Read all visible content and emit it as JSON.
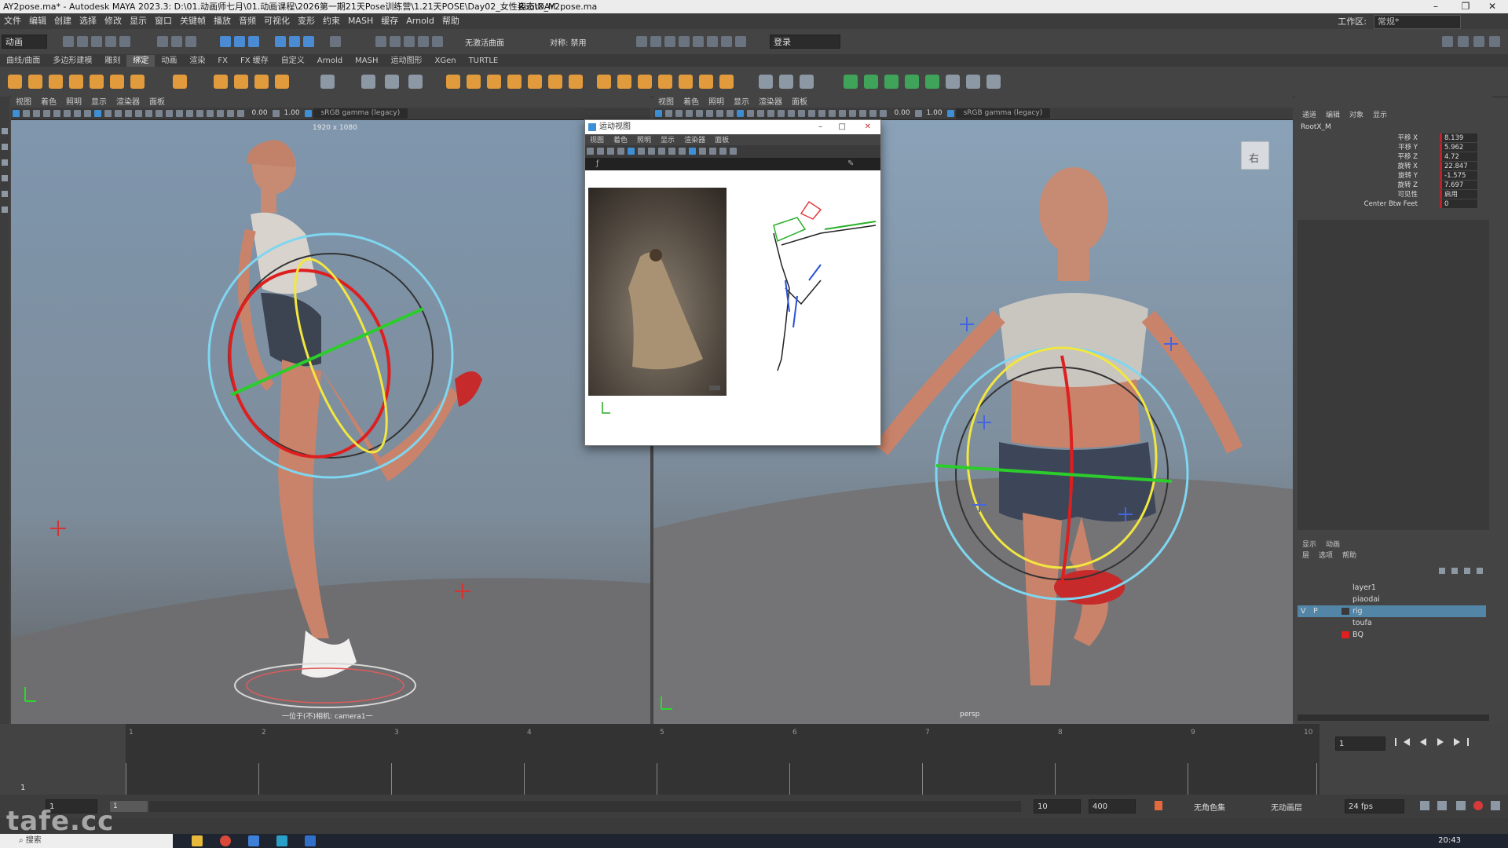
{
  "titlebar": {
    "title": "AY2pose.ma* - Autodesk MAYA 2023.3: D:\\01.动画师七月\\01.动画课程\\2026第一期21天Pose训练营\\1.21天POSE\\Day02_女性姿态\\DAY2pose.ma",
    "selection": "RootX_M",
    "minimize": "–",
    "restore": "❐",
    "close": "✕"
  },
  "menubar": {
    "items": [
      "文件",
      "编辑",
      "创建",
      "选择",
      "修改",
      "显示",
      "窗口",
      "关键帧",
      "播放",
      "音频",
      "可视化",
      "变形",
      "约束",
      "MASH",
      "缓存",
      "Arnold",
      "帮助"
    ],
    "workspace_label": "工作区:",
    "workspace_value": "常规*"
  },
  "statusline": {
    "mode": "动画",
    "symmetry": "无激活曲面",
    "symmetry_off": "对称: 禁用",
    "login": "登录"
  },
  "shelf": {
    "tabs": [
      "曲线/曲面",
      "多边形建模",
      "雕刻",
      "绑定",
      "动画",
      "渲染",
      "FX",
      "FX 缓存",
      "自定义",
      "Arnold",
      "MASH",
      "运动图形",
      "XGen",
      "TURTLE"
    ],
    "active_tab": 3
  },
  "viewport_left": {
    "menu": [
      "视图",
      "着色",
      "照明",
      "显示",
      "渲染器",
      "面板"
    ],
    "value1": "0.00",
    "value2": "1.00",
    "gamma": "sRGB gamma (legacy)",
    "resolution": "1920 x 1080",
    "camera_label": "一位于(不)相机: camera1一"
  },
  "viewport_right": {
    "menu": [
      "视图",
      "着色",
      "照明",
      "显示",
      "渲染器",
      "面板"
    ],
    "value1": "0.00",
    "value2": "1.00",
    "gamma": "sRGB gamma (legacy)",
    "camera_label": "persp",
    "viewcube_label": "右"
  },
  "float_window": {
    "title": "运动视图",
    "menu": [
      "视图",
      "着色",
      "照明",
      "显示",
      "渲染器",
      "面板"
    ]
  },
  "channel_box": {
    "tabs": [
      "通道",
      "编辑",
      "对象",
      "显示"
    ],
    "object": "RootX_M",
    "channels": [
      {
        "label": "平移 X",
        "value": "8.139"
      },
      {
        "label": "平移 Y",
        "value": "5.962"
      },
      {
        "label": "平移 Z",
        "value": "4.72"
      },
      {
        "label": "旋转 X",
        "value": "22.847"
      },
      {
        "label": "旋转 Y",
        "value": "-1.575"
      },
      {
        "label": "旋转 Z",
        "value": "7.697"
      },
      {
        "label": "可见性",
        "value": "启用"
      },
      {
        "label": "Center Btw Feet",
        "value": "0"
      }
    ]
  },
  "layer_editor": {
    "tabs": [
      "显示",
      "动画"
    ],
    "menu": [
      "层",
      "选项",
      "帮助"
    ],
    "layers": [
      {
        "name": "layer1",
        "color": "",
        "selected": false,
        "v": "",
        "p": ""
      },
      {
        "name": "piaodai",
        "color": "",
        "selected": false,
        "v": "",
        "p": ""
      },
      {
        "name": "rig",
        "color": "#3a3a3a",
        "selected": true,
        "v": "V",
        "p": "P"
      },
      {
        "name": "toufa",
        "color": "",
        "selected": false,
        "v": "",
        "p": ""
      },
      {
        "name": "BQ",
        "color": "#e02020",
        "selected": false,
        "v": "",
        "p": ""
      }
    ]
  },
  "timeline": {
    "ticks": [
      "1",
      "2",
      "3",
      "4",
      "5",
      "6",
      "7",
      "8",
      "9",
      "10"
    ],
    "current_frame": "1",
    "current_frame_field": "1"
  },
  "range": {
    "start": "1",
    "inner_start": "1",
    "inner_end": "10",
    "end": "400",
    "character_set": "无角色集",
    "anim_layer": "无动画层",
    "fps": "24 fps"
  },
  "taskbar": {
    "search": "搜索",
    "clock": "20:43"
  },
  "watermark": "tafe.cc"
}
